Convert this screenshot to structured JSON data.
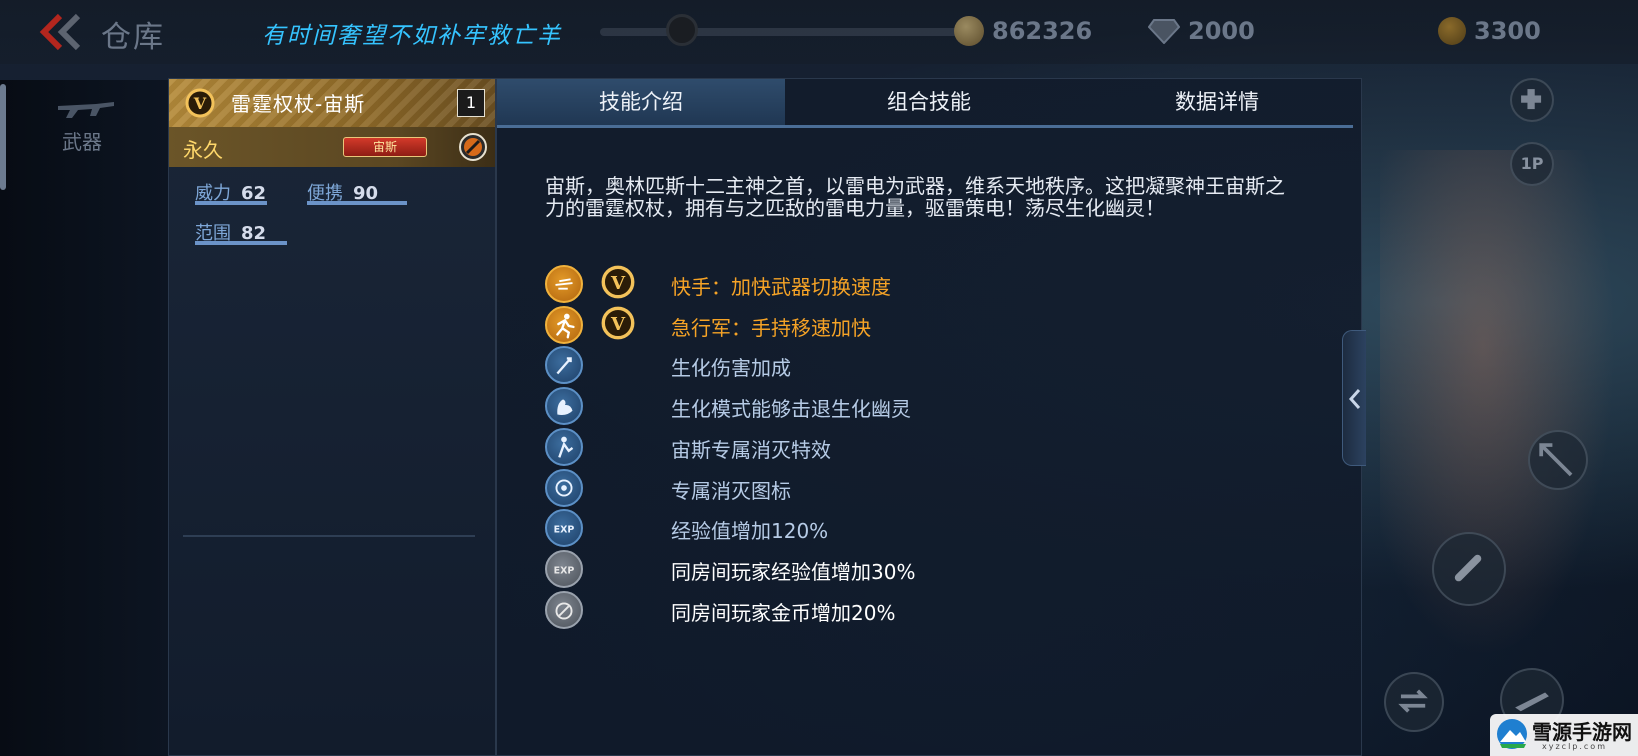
{
  "topbar": {
    "title": "仓库",
    "motto": "有时间奢望不如补牢救亡羊",
    "gold_coins": "862326",
    "diamonds": "2000",
    "points": "3300"
  },
  "nav": {
    "weapons_label": "武器"
  },
  "item": {
    "name": "雷霆权杖-宙斯",
    "count": "1",
    "duration": "永久",
    "series_tag": "宙斯",
    "stats": {
      "power_label": "威力",
      "power_value": "62",
      "portable_label": "便携",
      "portable_value": "90",
      "range_label": "范围",
      "range_value": "82"
    }
  },
  "tabs": [
    {
      "label": "技能介绍",
      "active": true
    },
    {
      "label": "组合技能",
      "active": false
    },
    {
      "label": "数据详情",
      "active": false
    }
  ],
  "description": "宙斯，奥林匹斯十二主神之首，以雷电为武器，维系天地秩序。这把凝聚神王宙斯之力的雷霆权杖，拥有与之匹敌的雷电力量，驱雷策电！荡尽生化幽灵！",
  "skills": [
    {
      "icon": "quick-hand-icon",
      "style": "gold",
      "vip": true,
      "text": "快手：加快武器切换速度",
      "color": "orange"
    },
    {
      "icon": "running-man-icon",
      "style": "gold",
      "vip": true,
      "text": "急行军：手持移速加快",
      "color": "orange"
    },
    {
      "icon": "bio-damage-icon",
      "style": "blue",
      "vip": false,
      "text": "生化伤害加成",
      "color": "blue"
    },
    {
      "icon": "muscle-arm-icon",
      "style": "blue",
      "vip": false,
      "text": "生化模式能够击退生化幽灵",
      "color": "blue"
    },
    {
      "icon": "kill-effect-icon",
      "style": "blue",
      "vip": false,
      "text": "宙斯专属消灭特效",
      "color": "blue"
    },
    {
      "icon": "kill-badge-icon",
      "style": "blue",
      "vip": false,
      "text": "专属消灭图标",
      "color": "blue"
    },
    {
      "icon": "exp-boost-icon",
      "style": "blue",
      "vip": false,
      "text": "经验值增加120%",
      "color": "blue"
    },
    {
      "icon": "room-exp-icon",
      "style": "gray",
      "vip": false,
      "text": "同房间玩家经验值增加30%",
      "color": "white"
    },
    {
      "icon": "room-gold-icon",
      "style": "gray",
      "vip": false,
      "text": "同房间玩家金币增加20%",
      "color": "white"
    }
  ],
  "side_buttons": {
    "one_p": "1P"
  },
  "watermark": {
    "name": "雪源手游网",
    "url": "xyzclp.com"
  },
  "colors": {
    "accent_blue": "#35c4ff",
    "skill_orange": "#f6a326",
    "header_gold": "#b58b3a"
  }
}
